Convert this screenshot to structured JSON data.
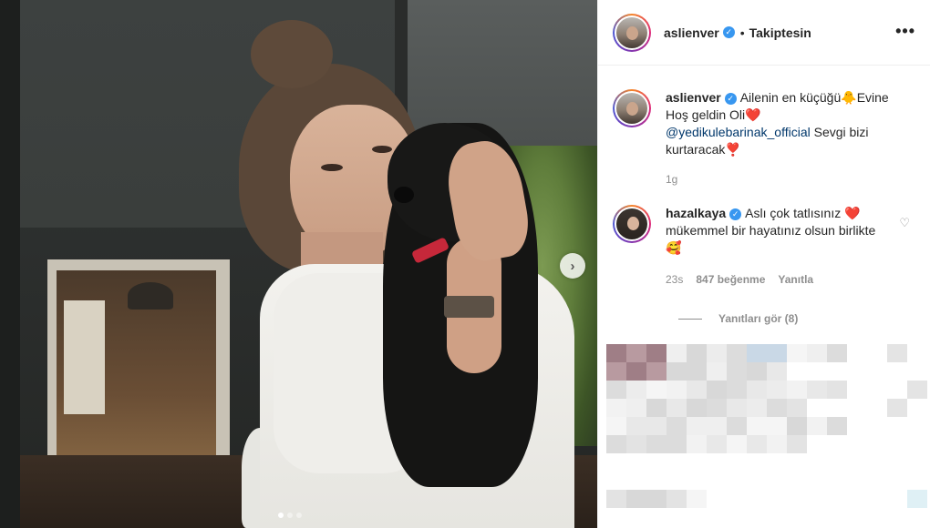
{
  "post": {
    "username": "aslienver",
    "verified": true,
    "follow_label": "Takiptesin",
    "more_label": "•••",
    "caption": {
      "text_1": "Ailenin en küçüğü",
      "emoji_1": "🐥",
      "text_2": "Evine Hoş geldin Oli",
      "emoji_2": "❤️",
      "mention": "@yedikulebarinak_official",
      "text_3": " Sevgi bizi kurtaracak",
      "emoji_3": "❣️",
      "time": "1g"
    }
  },
  "comments": [
    {
      "username": "hazalkaya",
      "verified": true,
      "text_1": "Aslı çok tatlısınız ",
      "emoji_1": "❤️",
      "text_2": " mükemmel bir hayatınız olsun birlikte ",
      "emoji_2": "🥰",
      "time": "23s",
      "likes": "847 beğenme",
      "reply_label": "Yanıtla",
      "view_replies": "Yanıtları gör (8)"
    }
  ],
  "carousel": {
    "total": 3,
    "active": 0
  },
  "colors": {
    "link": "#00376b",
    "verified": "#3897f0",
    "muted": "#8e8e8e"
  },
  "icons": [
    "next-arrow-icon",
    "verified-icon",
    "more-icon",
    "heart-outline-icon"
  ]
}
